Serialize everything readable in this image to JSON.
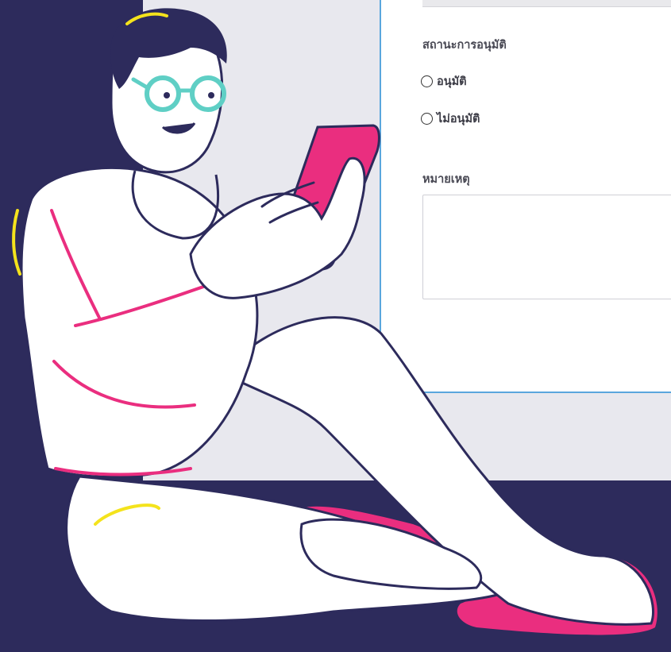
{
  "form": {
    "approval_status_label": "สถานะการอนุมัติ",
    "options": [
      {
        "label": "อนุมัติ",
        "selected": false
      },
      {
        "label": "ไม่อนุมัติ",
        "selected": false
      }
    ],
    "remark_label": "หมายเหตุ",
    "remark_value": ""
  },
  "illustration": {
    "subject": "man-sitting-with-tablet-icon",
    "colors": {
      "navy": "#2d2b5c",
      "pink": "#ea2e7f",
      "teal": "#5fcfc5",
      "yellow": "#f4e31c",
      "panel_border": "#5aa6dd"
    }
  }
}
